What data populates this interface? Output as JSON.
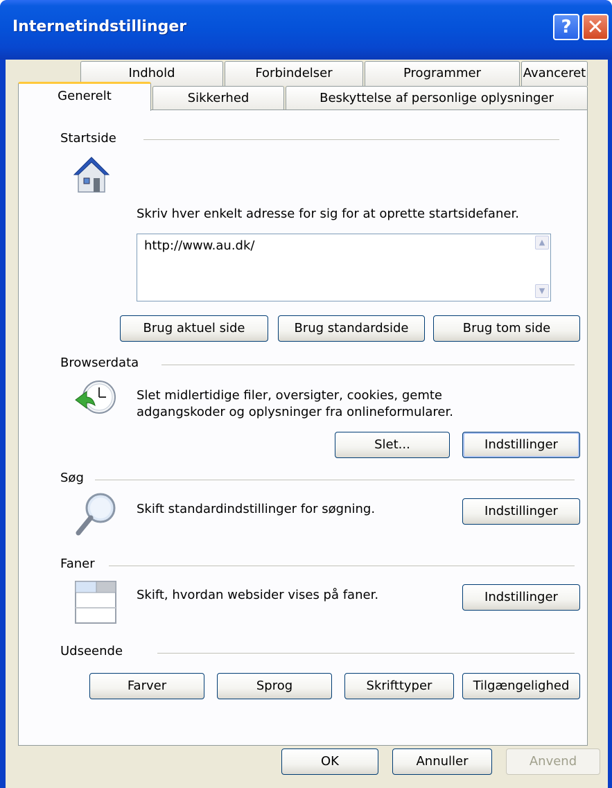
{
  "window": {
    "title": "Internetindstillinger",
    "help_glyph": "?",
    "close_glyph": "✕"
  },
  "tabs": {
    "row1": [
      "Indhold",
      "Forbindelser",
      "Programmer",
      "Avanceret"
    ],
    "row2": [
      "Generelt",
      "Sikkerhed",
      "Beskyttelse af personlige oplysninger"
    ]
  },
  "startside": {
    "title": "Startside",
    "description": "Skriv hver enkelt adresse for sig for at oprette startsidefaner.",
    "url_value": "http://www.au.dk/",
    "buttons": [
      "Brug aktuel side",
      "Brug standardside",
      "Brug tom side"
    ]
  },
  "browserdata": {
    "title": "Browserdata",
    "description_line1": "Slet midlertidige filer, oversigter, cookies, gemte",
    "description_line2": "adgangskoder og oplysninger fra onlineformularer.",
    "delete_button": "Slet...",
    "settings_button": "Indstillinger"
  },
  "search": {
    "title": "Søg",
    "description": "Skift standardindstillinger for søgning.",
    "settings_button": "Indstillinger"
  },
  "tabs_section": {
    "title": "Faner",
    "description": "Skift, hvordan websider vises på faner.",
    "settings_button": "Indstillinger"
  },
  "appearance": {
    "title": "Udseende",
    "buttons": [
      "Farver",
      "Sprog",
      "Skrifttyper",
      "Tilgængelighed"
    ]
  },
  "footer": {
    "ok": "OK",
    "cancel": "Annuller",
    "apply": "Anvend"
  },
  "icons": [
    "house-icon",
    "clock-icon",
    "magnifier-icon",
    "tabs-icon"
  ],
  "colors": {
    "title_bar": "#0551d8",
    "active_tab_accent": "#ffc83c",
    "dialog_bg": "#ece9d8"
  }
}
